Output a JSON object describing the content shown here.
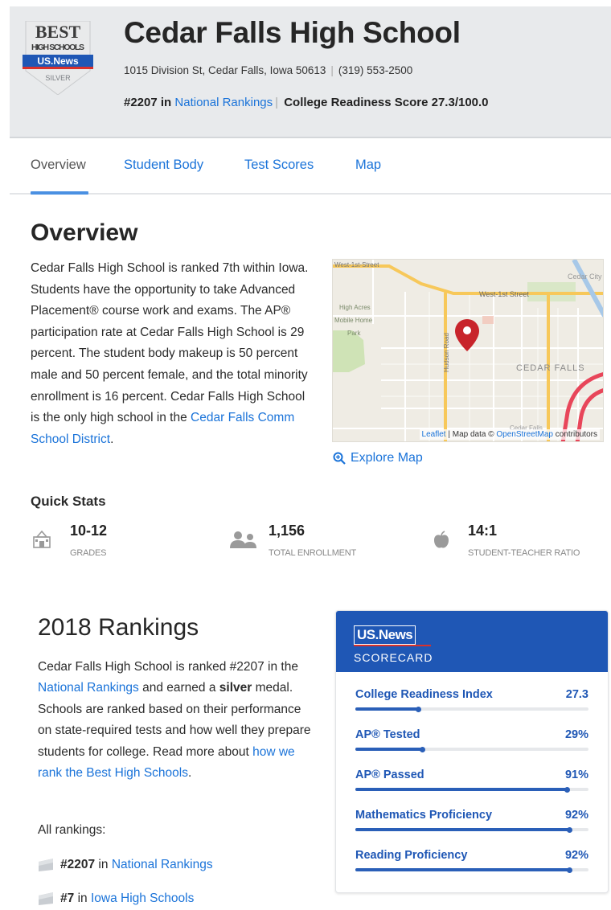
{
  "header": {
    "badge": {
      "line1": "BEST",
      "line2": "HIGH SCHOOLS",
      "line3": "US.News",
      "medal": "SILVER"
    },
    "school_name": "Cedar Falls High School",
    "address": "1015 Division St, Cedar Falls, Iowa 50613",
    "phone": "(319) 553-2500",
    "rank_prefix": "#2207 in",
    "rank_link": "National Rankings",
    "readiness": "College Readiness Score 27.3/100.0"
  },
  "tabs": [
    {
      "label": "Overview",
      "active": true
    },
    {
      "label": "Student Body",
      "active": false
    },
    {
      "label": "Test Scores",
      "active": false
    },
    {
      "label": "Map",
      "active": false
    }
  ],
  "overview": {
    "title": "Overview",
    "text_main": "Cedar Falls High School is ranked 7th within Iowa. Students have the opportunity to take Advanced Placement® course work and exams. The AP® participation rate at Cedar Falls High School is 29 percent. The student body makeup is 50 percent male and 50 percent female, and the total minority enrollment is 16 percent. Cedar Falls High School is the only high school in the ",
    "text_link": "Cedar Falls Comm School District",
    "text_end": "."
  },
  "map": {
    "labels": {
      "west1st_tl": "West-1st-Street",
      "west1st": "West-1st Street",
      "cedar_city": "Cedar City",
      "park": "High Acres Mobile Home Park",
      "park_l1": "High Acres",
      "park_l2": "Mobile Home",
      "park_l3": "Park",
      "hudson": "Hudson Road",
      "cedar_falls": "CEDAR FALLS",
      "bottom": "Cedar Falls"
    },
    "attribution_leaflet": "Leaflet",
    "attribution_mid": " | Map data © ",
    "attribution_osm": "OpenStreetMap",
    "attribution_end": " contributors",
    "explore": "Explore Map",
    "colors": {
      "road_major": "#f7c85a",
      "road_minor": "#ffffff",
      "background": "#efece4",
      "park": "#cfe3b6",
      "pin": "#c8242b",
      "highway": "#e8465a"
    }
  },
  "quick_stats": {
    "title": "Quick Stats",
    "items": [
      {
        "icon": "school-building-icon",
        "value": "10-12",
        "label": "GRADES"
      },
      {
        "icon": "people-icon",
        "value": "1,156",
        "label": "TOTAL ENROLLMENT"
      },
      {
        "icon": "apple-icon",
        "value": "14:1",
        "label": "STUDENT-TEACHER RATIO"
      }
    ]
  },
  "rankings": {
    "title": "2018 Rankings",
    "text_1": "Cedar Falls High School is ranked #2207 in the ",
    "link_1": "National Rankings",
    "text_2": " and earned a ",
    "medal": "silver",
    "text_3": " medal. Schools are ranked based on their performance on state-required tests and how well they prepare students for college. Read more about ",
    "link_2": "how we rank the Best High Schools",
    "text_4": ".",
    "all_label": "All rankings:",
    "items": [
      {
        "rank": "#2207",
        "mid": "in",
        "link": "National Rankings"
      },
      {
        "rank": "#7",
        "mid": "in",
        "link": "Iowa High Schools"
      }
    ]
  },
  "scorecard": {
    "logo": "US.News",
    "subtitle": "SCORECARD",
    "brand_color": "#1f57b5",
    "rows": [
      {
        "label": "College Readiness Index",
        "value": "27.3",
        "fraction": 0.273
      },
      {
        "label": "AP® Tested",
        "value": "29%",
        "fraction": 0.29
      },
      {
        "label": "AP® Passed",
        "value": "91%",
        "fraction": 0.91
      },
      {
        "label": "Mathematics Proficiency",
        "value": "92%",
        "fraction": 0.92
      },
      {
        "label": "Reading Proficiency",
        "value": "92%",
        "fraction": 0.92
      }
    ]
  }
}
